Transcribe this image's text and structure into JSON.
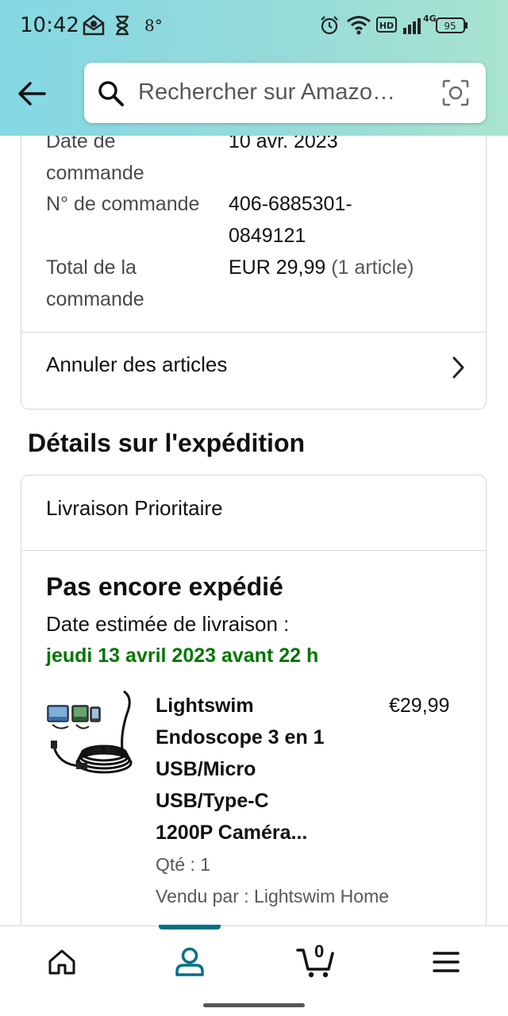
{
  "status_bar": {
    "time": "10:42",
    "temperature": "8°",
    "battery": "95",
    "network": "4G",
    "hd": "HD"
  },
  "search": {
    "placeholder": "Rechercher sur Amazo…"
  },
  "order": {
    "date_label": "Date de commande",
    "date_value": "10 avr. 2023",
    "number_label": "N° de commande",
    "number_value_1": "406-6885301-",
    "number_value_2": "0849121",
    "total_label": "Total de la commande",
    "total_value": "EUR 29,99",
    "total_count": "(1 article)",
    "cancel_label": "Annuler des articles"
  },
  "shipping": {
    "section_title": "Détails sur l'expédition",
    "method": "Livraison Prioritaire",
    "status": "Pas encore expédié",
    "estimate_label": "Date estimée de livraison :",
    "estimate_date": "jeudi 13 avril 2023 avant 22 h",
    "accent_color": "#007600"
  },
  "item": {
    "title_lines": [
      "Lightswim",
      "Endoscope 3 en 1",
      "USB/Micro",
      "USB/Type-C",
      "1200P Caméra..."
    ],
    "price": "€29,99",
    "qty": "Qté : 1",
    "seller": "Vendu par : Lightswim Home"
  },
  "bottom_nav": {
    "cart_count": "0",
    "active_tab": "account",
    "accent_color": "#007185"
  }
}
